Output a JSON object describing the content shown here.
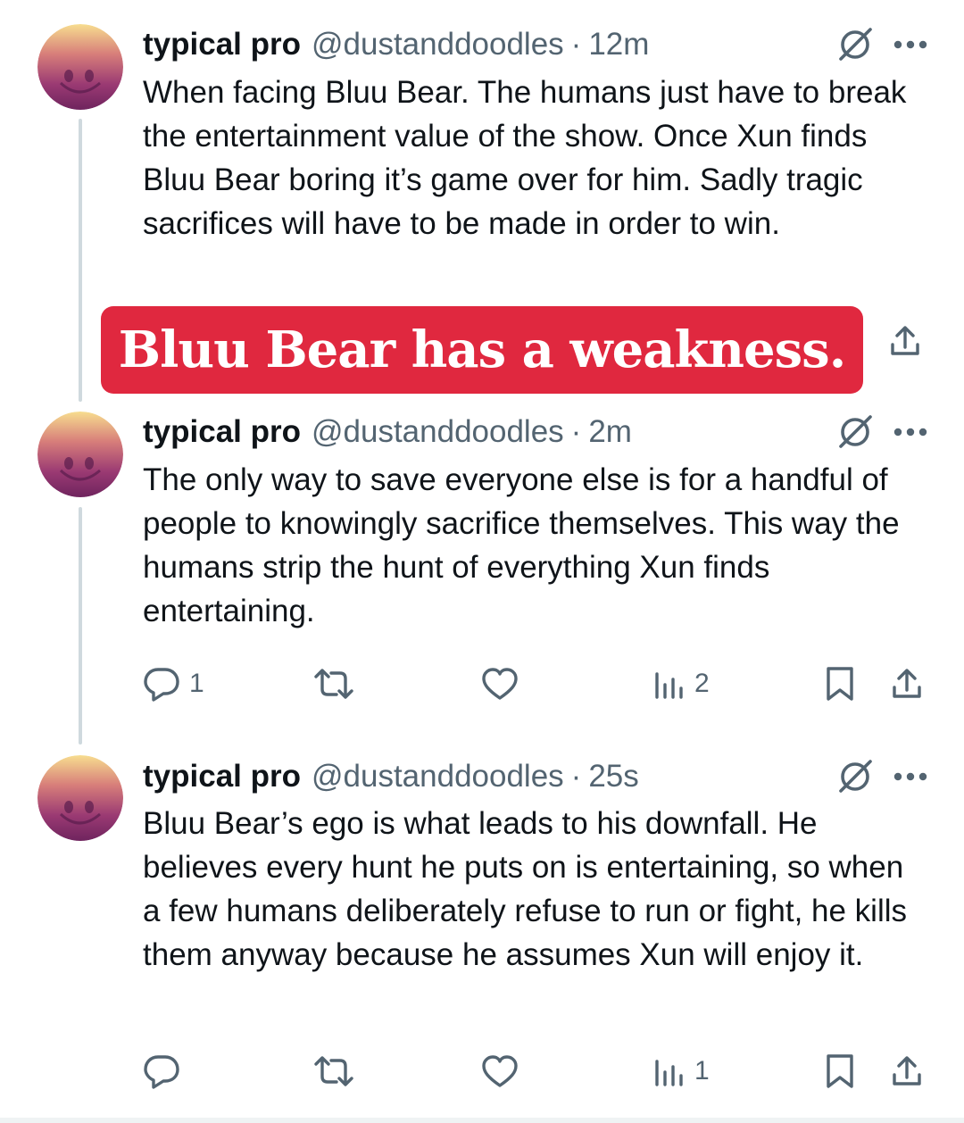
{
  "tweets": [
    {
      "name": "typical pro",
      "handle": "@dustanddoodles",
      "separator": "·",
      "time": "12m",
      "text": "When facing Bluu Bear. The humans just have to break the entertainment value of the show. Once Xun finds Bluu Bear boring it’s game over for him. Sadly tragic sacrifices will have to be made in order to win.",
      "image_caption": "Bluu Bear has a weakness."
    },
    {
      "name": "typical pro",
      "handle": "@dustanddoodles",
      "separator": "·",
      "time": "2m",
      "text": "The only way to save everyone else is for a handful of people to knowingly sacrifice themselves. This way the humans strip the hunt of everything Xun finds entertaining.",
      "replies": "1",
      "views": "2"
    },
    {
      "name": "typical pro",
      "handle": "@dustanddoodles",
      "separator": "·",
      "time": "25s",
      "text": "Bluu Bear’s ego is what leads to his downfall. He believes every hunt he puts on is entertaining, so when a few humans deliberately refuse to run or fight, he kills them anyway because he assumes Xun will enjoy it.",
      "replies": "",
      "views": "1"
    }
  ],
  "icons": {
    "more": "more-dots-icon",
    "grok": "grok-icon",
    "reply": "reply-bubble-icon",
    "retweet": "retweet-icon",
    "like": "heart-icon",
    "views": "views-bars-icon",
    "bookmark": "bookmark-icon",
    "share": "share-upload-icon"
  },
  "colors": {
    "text": "#0f1419",
    "muted": "#536471",
    "thread_line": "#cfd9de",
    "banner": "#e0283f"
  }
}
